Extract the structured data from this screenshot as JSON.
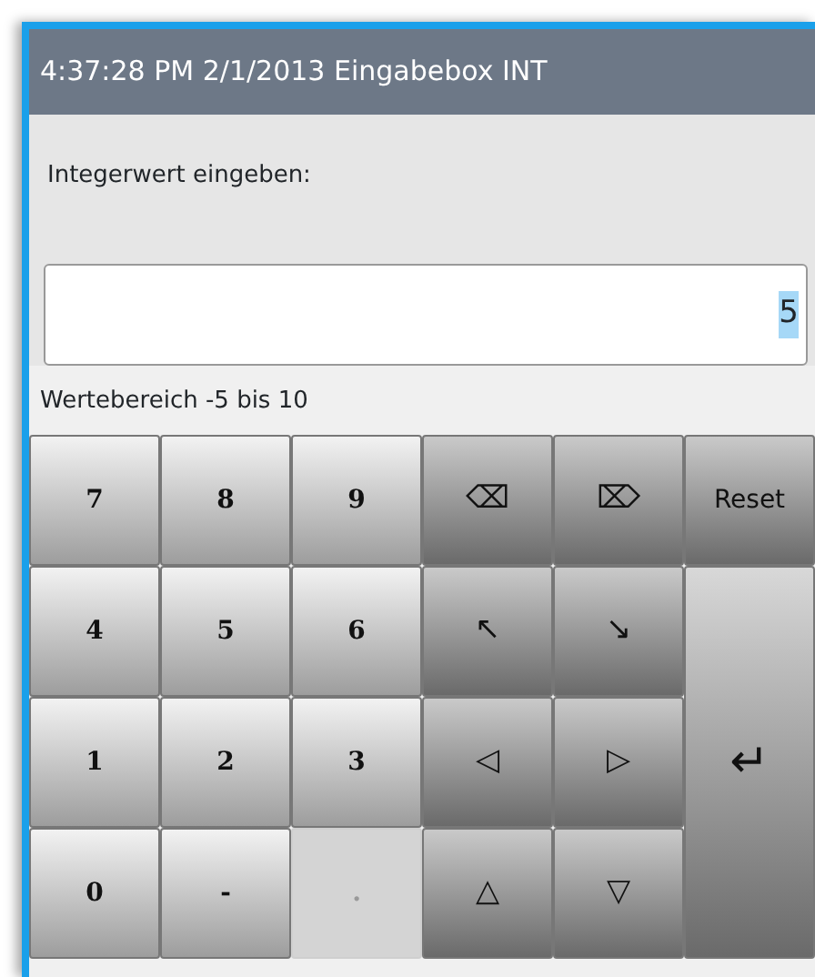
{
  "window": {
    "title": "4:37:28 PM 2/1/2013 Eingabebox INT"
  },
  "prompt": "Integerwert eingeben:",
  "field": {
    "value": "5",
    "value_selected": true
  },
  "range_hint": "Wertebereich -5 bis 10",
  "keys": [
    {
      "label": "7",
      "kind": "digit",
      "disabled": false
    },
    {
      "label": "8",
      "kind": "digit",
      "disabled": false
    },
    {
      "label": "9",
      "kind": "digit",
      "disabled": false
    },
    {
      "label": "⌫",
      "kind": "function",
      "disabled": false
    },
    {
      "label": "⌦",
      "kind": "function",
      "disabled": false
    },
    {
      "label": "Reset",
      "kind": "function",
      "disabled": false
    },
    {
      "label": "4",
      "kind": "digit",
      "disabled": false
    },
    {
      "label": "5",
      "kind": "digit",
      "disabled": false
    },
    {
      "label": "6",
      "kind": "digit",
      "disabled": false
    },
    {
      "label": "↖",
      "kind": "function",
      "disabled": false
    },
    {
      "label": "↘",
      "kind": "function",
      "disabled": false
    },
    {
      "label": "1",
      "kind": "digit",
      "disabled": false
    },
    {
      "label": "2",
      "kind": "digit",
      "disabled": false
    },
    {
      "label": "3",
      "kind": "digit",
      "disabled": false
    },
    {
      "label": "◁",
      "kind": "function",
      "disabled": false
    },
    {
      "label": "▷",
      "kind": "function",
      "disabled": false
    },
    {
      "label": "↵",
      "kind": "enter",
      "disabled": false
    },
    {
      "label": "0",
      "kind": "digit",
      "disabled": false
    },
    {
      "label": "-",
      "kind": "digit",
      "disabled": false
    },
    {
      "label": ".",
      "kind": "digit",
      "disabled": true
    },
    {
      "label": "△",
      "kind": "function",
      "disabled": false
    },
    {
      "label": "▽",
      "kind": "function",
      "disabled": false
    }
  ]
}
